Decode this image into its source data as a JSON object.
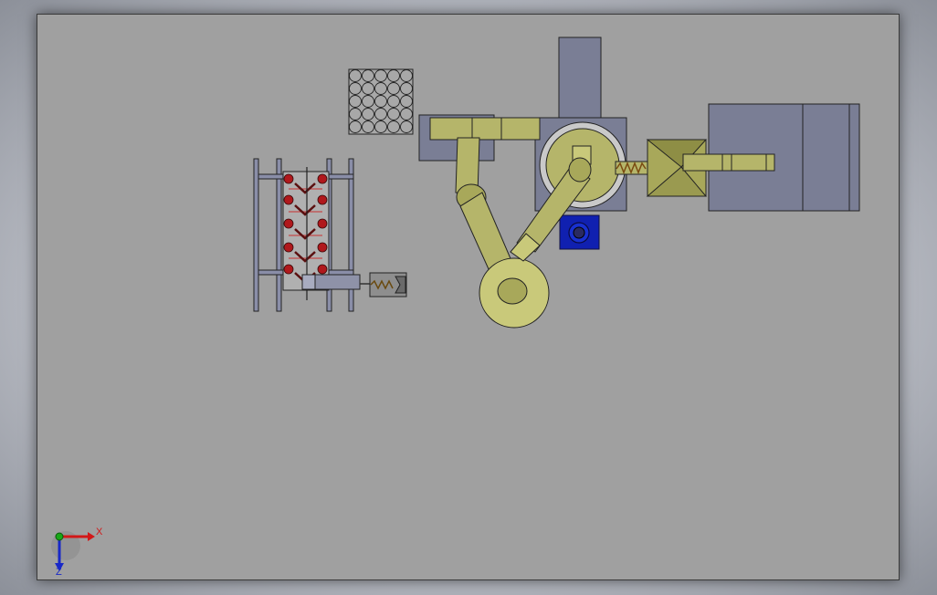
{
  "triad": {
    "x_label": "X",
    "z_label": "Z"
  },
  "colors": {
    "background": "#a0a0a0",
    "robot_arm": "#b5b56a",
    "arm_dark": "#8e8e45",
    "base_plate": "#7a7e95",
    "blue_motor": "#1020b0",
    "red_part": "#b0181c",
    "axis_x": "#d21818",
    "axis_y": "#18a818",
    "axis_z": "#1828c8"
  },
  "icons": [
    "triad-icon"
  ]
}
